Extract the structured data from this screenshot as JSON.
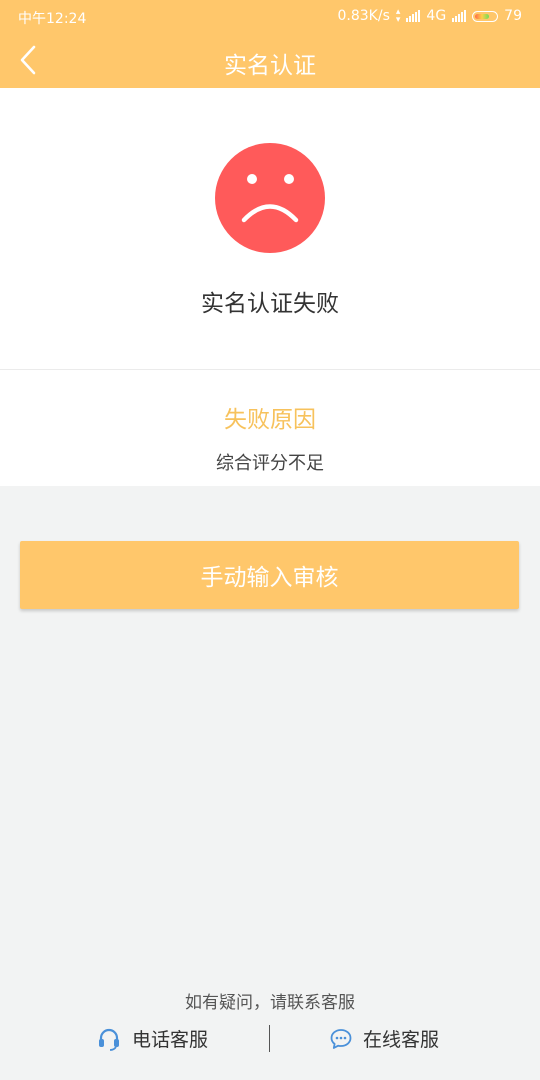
{
  "status_bar": {
    "time": "中午12:24",
    "network_speed": "0.83K/s",
    "network_type": "4G",
    "battery": "79",
    "battery_level_percent": 79
  },
  "nav": {
    "title": "实名认证",
    "back_icon": "chevron-left-icon"
  },
  "result": {
    "icon": "sad-face-icon",
    "title": "实名认证失败"
  },
  "reason": {
    "title": "失败原因",
    "text": "综合评分不足"
  },
  "actions": {
    "manual_review_label": "手动输入审核"
  },
  "help": {
    "text": "如有疑问，请联系客服",
    "phone_label": "电话客服",
    "phone_icon": "headset-icon",
    "online_label": "在线客服",
    "online_icon": "chat-bubble-icon"
  },
  "colors": {
    "accent": "#ffc76b",
    "error": "#ff5a5a",
    "reason_title": "#f7c25c",
    "background": "#f2f3f3",
    "contact_icon": "#4a90d9"
  }
}
